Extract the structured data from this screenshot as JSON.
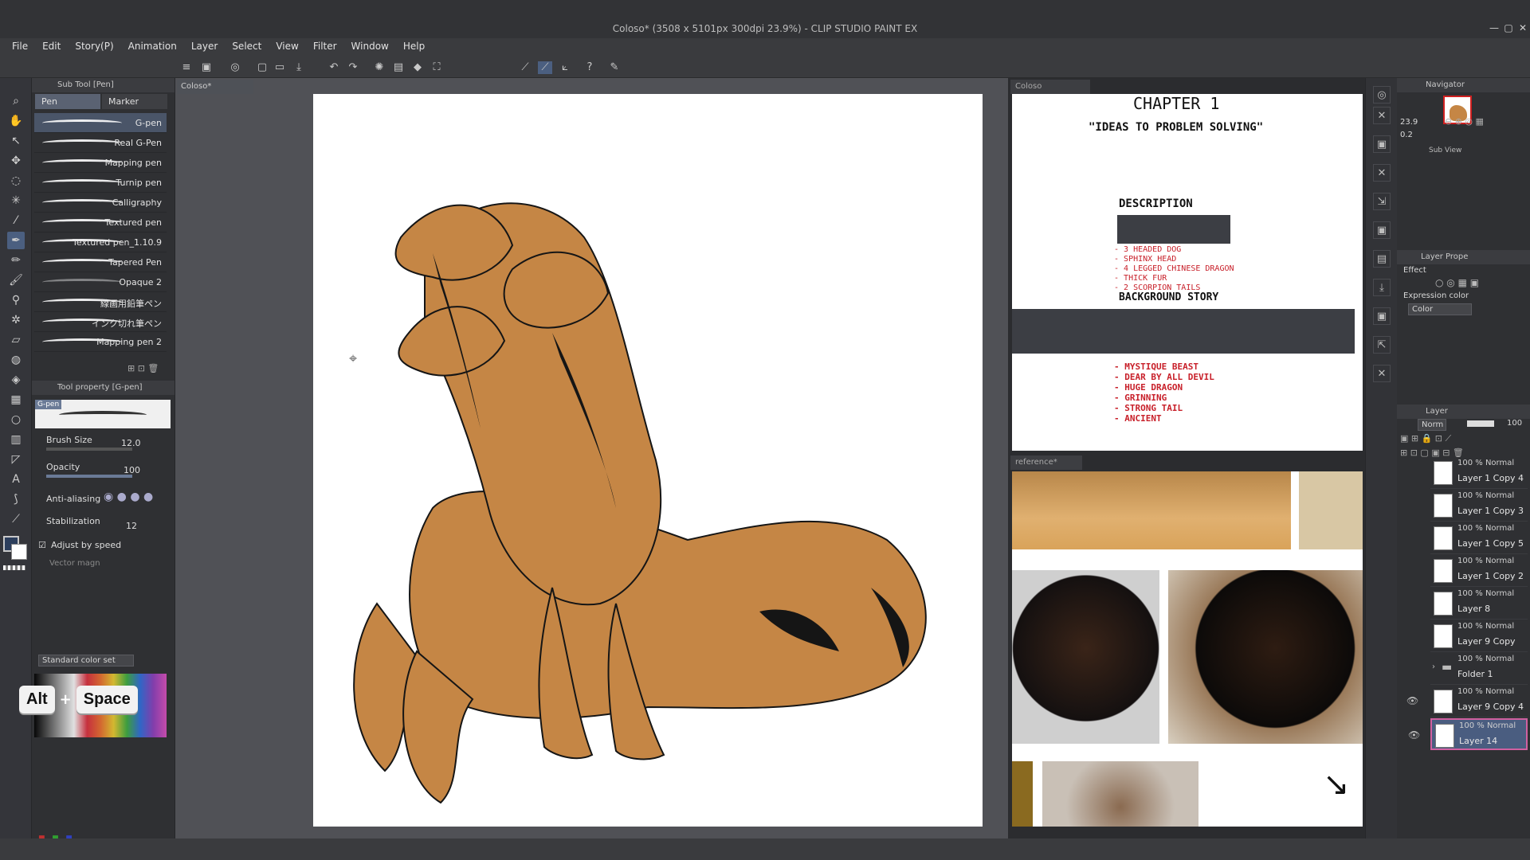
{
  "window": {
    "title": "Coloso* (3508 x 5101px 300dpi 23.9%) - CLIP STUDIO PAINT EX"
  },
  "menu": [
    "File",
    "Edit",
    "Story(P)",
    "Animation",
    "Layer",
    "Select",
    "View",
    "Filter",
    "Window",
    "Help"
  ],
  "subtool": {
    "header": "Sub Tool [Pen]",
    "tabs": [
      "Pen",
      "Marker"
    ],
    "brushes": [
      "G-pen",
      "Real G-Pen",
      "Mapping pen",
      "Turnip pen",
      "Calligraphy",
      "Textured pen",
      "Textured pen_1.10.9",
      "Tapered Pen",
      "Opaque 2",
      "線画用鉛筆ペン",
      "インク切れ筆ペン",
      "Mapping pen 2"
    ]
  },
  "tool_property": {
    "header": "Tool property [G-pen]",
    "preview_label": "G-pen",
    "brush_size_label": "Brush Size",
    "brush_size_value": "12.0",
    "opacity_label": "Opacity",
    "opacity_value": "100",
    "anti_aliasing_label": "Anti-aliasing",
    "stabilization_label": "Stabilization",
    "stabilization_value": "12",
    "adjust_by_speed_label": "Adjust by speed",
    "vector_magnet_label": "Vector magn"
  },
  "color_set": {
    "select_value": "Standard color set"
  },
  "shortcut": {
    "key1": "Alt",
    "plus": "+",
    "key2": "Space"
  },
  "document": {
    "tab": "Coloso*"
  },
  "sub_view_top": {
    "tab": "Coloso",
    "chapter": "CHAPTER 1",
    "subtitle": "\"IDEAS TO PROBLEM SOLVING\"",
    "description_heading": "DESCRIPTION",
    "description_list": [
      "3 HEADED DOG",
      "SPHINX HEAD",
      "4 LEGGED CHINESE DRAGON",
      "THICK FUR",
      "2 SCORPION TAILS"
    ],
    "background_heading": "BACKGROUND STORY",
    "story_list": [
      "MYSTIQUE BEAST",
      "DEAR BY ALL  DEVIL",
      "HUGE DRAGON",
      "GRINNING",
      "STRONG TAIL",
      "ANCIENT"
    ]
  },
  "sub_view_bottom": {
    "tab": "reference*"
  },
  "navigator": {
    "header": "Navigator",
    "zoom": "23.9",
    "rotate": "0.2",
    "sub_view_label": "Sub View"
  },
  "layer_property": {
    "header": "Layer Prope",
    "effect_label": "Effect",
    "expression_color_label": "Expression color",
    "expression_color_value": "Color"
  },
  "layers": {
    "header": "Layer",
    "blend_mode": "Norm",
    "opacity": "100",
    "items": [
      {
        "mode": "100 % Normal",
        "name": "Layer 1 Copy 4"
      },
      {
        "mode": "100 % Normal",
        "name": "Layer 1 Copy 3"
      },
      {
        "mode": "100 % Normal",
        "name": "Layer 1 Copy 5"
      },
      {
        "mode": "100 % Normal",
        "name": "Layer 1 Copy 2"
      },
      {
        "mode": "100 % Normal",
        "name": "Layer 8"
      },
      {
        "mode": "100 % Normal",
        "name": "Layer 9 Copy"
      },
      {
        "mode": "100 % Normal",
        "name": "Folder 1"
      },
      {
        "mode": "100 % Normal",
        "name": "Layer 9 Copy 4"
      },
      {
        "mode": "100 % Normal",
        "name": "Layer 14"
      }
    ]
  },
  "colors": {
    "accent": "#4a5d80",
    "fill": "#c58645",
    "ink": "#151515"
  }
}
